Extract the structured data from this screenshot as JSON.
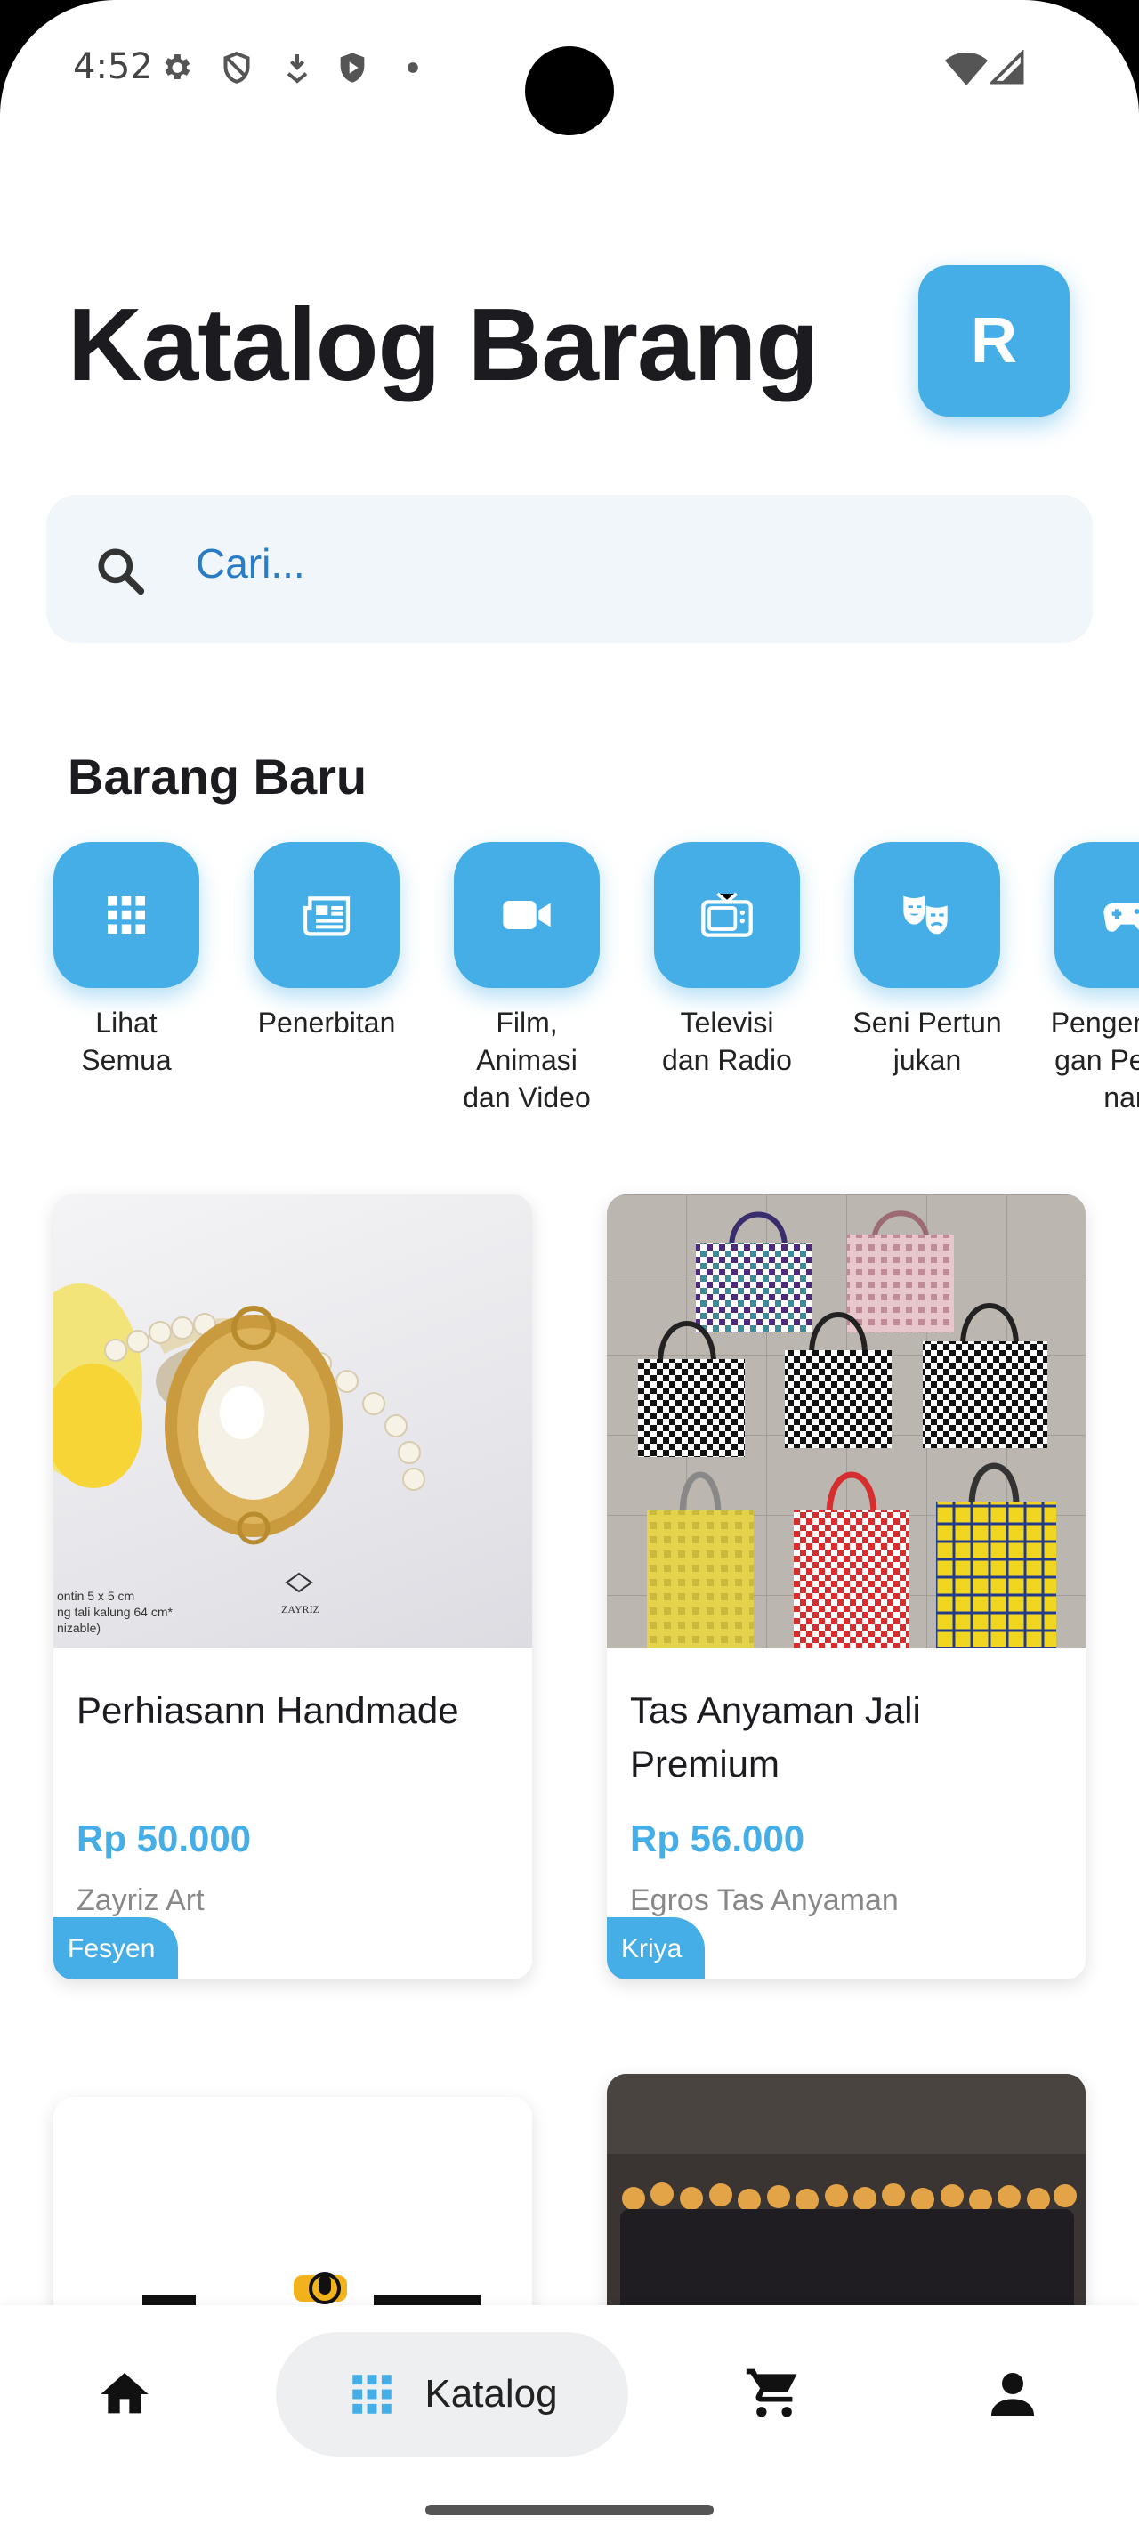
{
  "status_bar": {
    "time": "4:52",
    "icons": [
      "settings-icon",
      "shield-icon",
      "download-icon",
      "play-protect-icon",
      "dot-icon",
      "wifi-icon",
      "signal-icon"
    ]
  },
  "header": {
    "title": "Katalog Barang",
    "avatar_letter": "R"
  },
  "search": {
    "placeholder": "Cari..."
  },
  "section": {
    "title": "Barang Baru"
  },
  "categories": [
    {
      "label": "Lihat Semua",
      "icon": "grid-icon"
    },
    {
      "label": "Penerbitan",
      "icon": "newspaper-icon"
    },
    {
      "label": "Film, Animasi dan Video",
      "icon": "video-camera-icon"
    },
    {
      "label": "Televisi dan Radio",
      "icon": "tv-icon"
    },
    {
      "label": "Seni Pertunjukan",
      "icon": "theater-masks-icon"
    },
    {
      "label": "Pengembangan Permainan",
      "icon": "gamepad-icon"
    }
  ],
  "products": [
    {
      "name": "Perhiasann Handmade",
      "price": "Rp 50.000",
      "seller": "Zayriz Art",
      "tag": "Fesyen",
      "image_caption": "ontin 5 x 5 cm\nng tali kalung 64 cm*\nnizable)",
      "brand": "ZAYRIZ"
    },
    {
      "name": "Tas Anyaman Jali Premium",
      "price": "Rp 56.000",
      "seller": "Egros Tas Anyaman",
      "tag": "Kriya"
    }
  ],
  "bottom_nav": {
    "items": [
      {
        "label": "Home",
        "icon": "home-icon"
      },
      {
        "label": "Katalog",
        "icon": "grid-icon"
      },
      {
        "label": "Cart",
        "icon": "cart-icon"
      },
      {
        "label": "Profile",
        "icon": "person-icon"
      }
    ]
  },
  "colors": {
    "accent": "#45aee6",
    "title": "#1c1b20",
    "search_bg": "#f1f6fa",
    "search_text": "#2a7cc4"
  }
}
